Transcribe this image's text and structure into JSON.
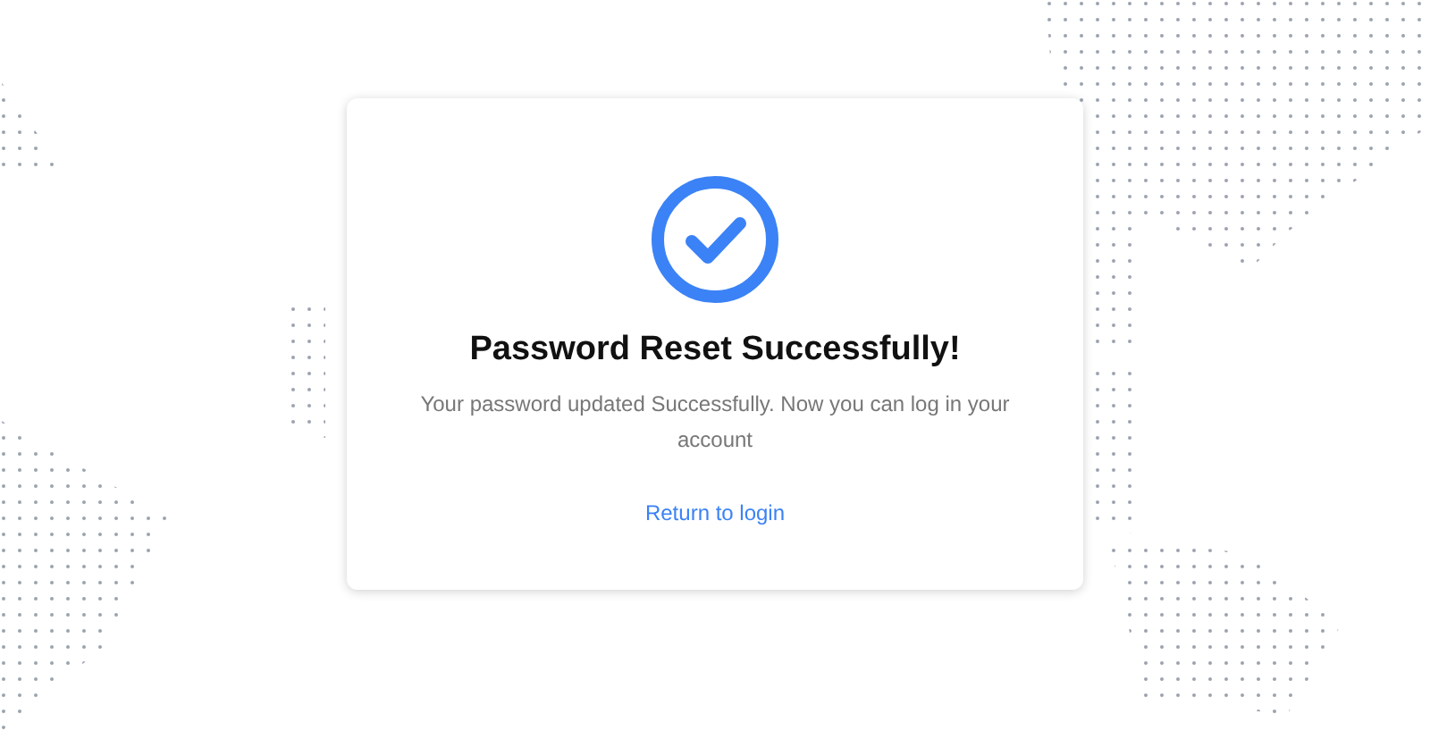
{
  "card": {
    "title": "Password Reset Successfully!",
    "message": "Your password updated Successfully. Now you can log in your account",
    "link": "Return to login"
  }
}
